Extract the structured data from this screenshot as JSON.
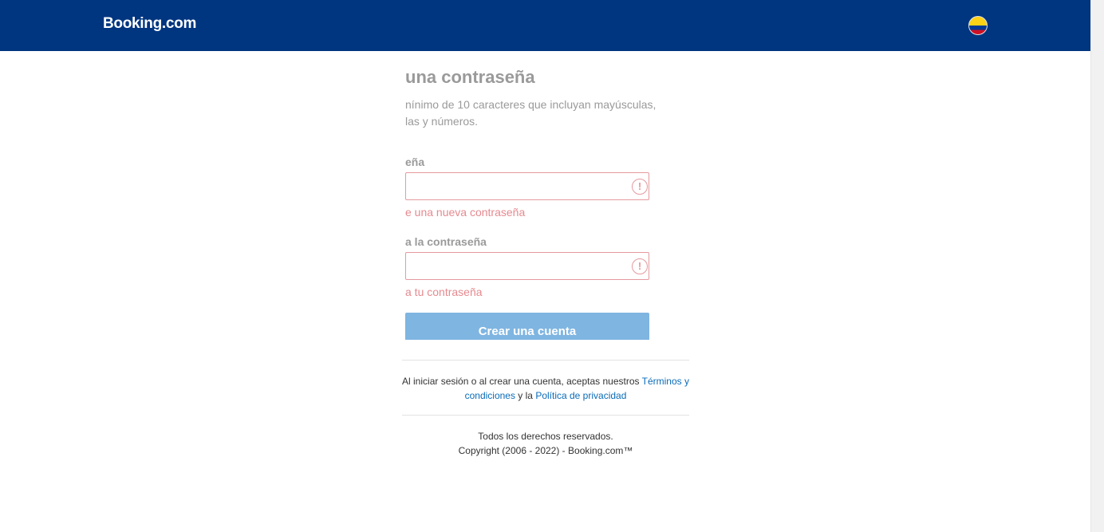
{
  "header": {
    "logo": "Booking.com",
    "flag": "colombia-flag",
    "bg_color": "#003580"
  },
  "form": {
    "title": "una contraseña",
    "description": "nínimo de 10 caracteres que incluyan mayúsculas, las y números.",
    "password_label": "eña",
    "password_error": "e una nueva contraseña",
    "confirm_label": "a la contraseña",
    "confirm_error": "a tu contraseña",
    "error_icon": "!",
    "submit_label": "Crear una cuenta",
    "error_color": "#e59a9e",
    "button_color": "#7fb5e1"
  },
  "terms": {
    "prefix": "Al iniciar sesión o al crear una cuenta, aceptas nuestros ",
    "terms_link": "Términos y condiciones",
    "middle": " y la ",
    "privacy_link": "Política de privacidad"
  },
  "footer": {
    "rights": "Todos los derechos reservados.",
    "copyright": "Copyright (2006 - 2022) - Booking.com™"
  }
}
